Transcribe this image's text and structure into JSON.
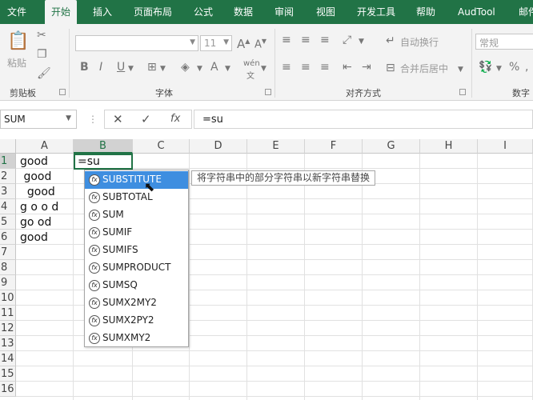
{
  "tabs": [
    "文件",
    "开始",
    "插入",
    "页面布局",
    "公式",
    "数据",
    "审阅",
    "视图",
    "开发工具",
    "帮助",
    "AudTool",
    "邮件"
  ],
  "active_tab": "开始",
  "ribbon": {
    "clipboard": {
      "paste_label": "粘贴",
      "group_label": "剪贴板"
    },
    "font": {
      "font_name": "",
      "font_size": "11",
      "group_label": "字体",
      "wen_label": "wén",
      "wen_sub": "文"
    },
    "alignment": {
      "wrap_text_label": "自动换行",
      "merge_label": "合并后居中",
      "group_label": "对齐方式"
    },
    "number": {
      "format_value": "常规",
      "group_label": "数字"
    }
  },
  "formula_bar": {
    "name_box": "SUM",
    "cancel_icon": "close-icon",
    "enter_icon": "check-icon",
    "fx_label": "fx",
    "formula": "=su"
  },
  "columns": [
    "A",
    "B",
    "C",
    "D",
    "E",
    "F",
    "G",
    "H",
    "I"
  ],
  "selected_column": "B",
  "rows": [
    "1",
    "2",
    "3",
    "4",
    "5",
    "6",
    "7",
    "8",
    "9",
    "10",
    "11",
    "12",
    "13",
    "14",
    "15",
    "16"
  ],
  "selected_row": "1",
  "cells": {
    "A1": "good",
    "A2": " good",
    "A3": "  good",
    "A4": "g o o d",
    "A5": "go od",
    "A6": "good",
    "B1": "=su"
  },
  "autocomplete": {
    "items": [
      "SUBSTITUTE",
      "SUBTOTAL",
      "SUM",
      "SUMIF",
      "SUMIFS",
      "SUMPRODUCT",
      "SUMSQ",
      "SUMX2MY2",
      "SUMX2PY2",
      "SUMXMY2"
    ],
    "selected": "SUBSTITUTE",
    "item_icon": "function-icon",
    "tooltip": "将字符串中的部分字符串以新字符串替换"
  },
  "colors": {
    "brand": "#217346",
    "selection": "#3e8ee0"
  }
}
